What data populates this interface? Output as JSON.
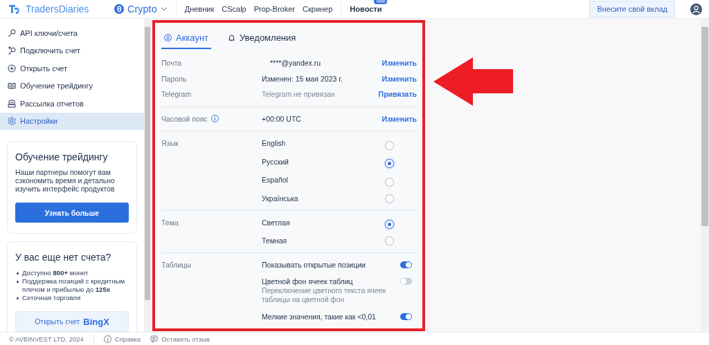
{
  "header": {
    "logo": "TradersDiaries",
    "product": "Crypto",
    "nav": [
      {
        "label": "Дневник"
      },
      {
        "label": "CScalp"
      },
      {
        "label": "Prop-Broker"
      },
      {
        "label": "Скринер"
      }
    ],
    "news": {
      "label": "Новости",
      "badge": "New"
    },
    "contribute_button": "Внесите свой вклад"
  },
  "sidebar": {
    "items": [
      {
        "label": "API ключи/счета",
        "selected": false
      },
      {
        "label": "Подключить счет",
        "selected": false
      },
      {
        "label": "Открыть счет",
        "selected": false
      },
      {
        "label": "Обучение трейдингу",
        "selected": false
      },
      {
        "label": "Рассылка отчетов",
        "selected": false
      },
      {
        "label": "Настройки",
        "selected": true
      }
    ],
    "promo_cards": [
      {
        "title": "Обучение трейдингу",
        "text": "Наши партнеры помогут вам сэкономить время и детально изучить интерфейс продуктов",
        "button": "Узнать больше"
      },
      {
        "title": "У вас еще нет счета?",
        "bullets": [
          "Доступно **800+** монет",
          "Поддержка позиций с кредитным плечом и прибылью до **125x**",
          "Сеточная торговля"
        ],
        "button": "Открыть счет",
        "button_logo": "BingX"
      }
    ]
  },
  "tabs": [
    {
      "label": "Аккаунт",
      "selected": true
    },
    {
      "label": "Уведомления",
      "selected": false
    }
  ],
  "account_rows": [
    {
      "label": "Почта",
      "value": "****@yandex.ru",
      "muted": false,
      "action": "Изменить"
    },
    {
      "label": "Пароль",
      "value": "Изменен: 15 мая 2023 г.",
      "muted": false,
      "action": "Изменить"
    },
    {
      "label": "Telegram",
      "value": "Telegram не привязан",
      "muted": true,
      "action": "Привязать"
    }
  ],
  "timezone": {
    "label": "Часовой пояс",
    "value": "+00:00 UTC",
    "action": "Изменить"
  },
  "language": {
    "label": "Язык",
    "options": [
      {
        "label": "English",
        "selected": false
      },
      {
        "label": "Русский",
        "selected": true
      },
      {
        "label": "Español",
        "selected": false
      },
      {
        "label": "Українська",
        "selected": false
      }
    ]
  },
  "theme": {
    "label": "Тема",
    "options": [
      {
        "label": "Светлая",
        "selected": true
      },
      {
        "label": "Темная",
        "selected": false
      }
    ]
  },
  "tables": {
    "label": "Таблицы",
    "toggles": [
      {
        "label": "Показывать открытые позиции",
        "on": true
      },
      {
        "label": "Цветной фон ячеек таблиц",
        "description": "Переключение цветного текста ячеек таблицы на цветной фон",
        "on": false
      },
      {
        "label": "Мелкие значения, такие как <0,01",
        "on": true
      }
    ]
  },
  "footer": {
    "copyright": "© AVBINVEST LTD, 2024",
    "links": [
      "Справка",
      "Оставить отзыв"
    ]
  }
}
